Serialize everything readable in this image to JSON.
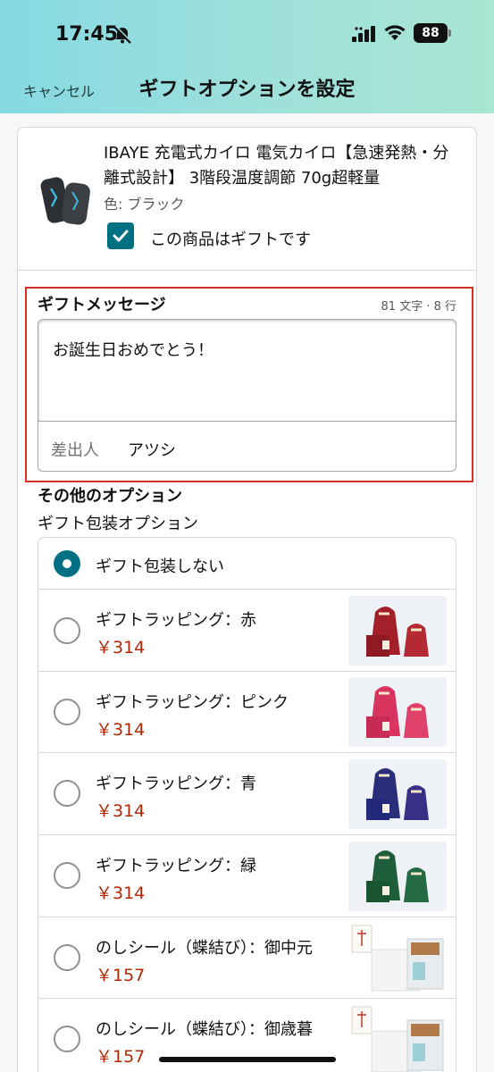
{
  "status_bar": {
    "time": "17:45",
    "battery": "88"
  },
  "nav": {
    "cancel": "キャンセル",
    "title": "ギフトオプションを設定"
  },
  "product": {
    "title": "IBAYE 充電式カイロ 電気カイロ【急速発熱・分離式設計】 3階段温度調節 70g超軽量",
    "color": "色: ブラック",
    "gift_checkbox_label": "この商品はギフトです",
    "gift_checked": true
  },
  "gift_message": {
    "heading": "ギフトメッセージ",
    "counter": "81 文字 · 8 行",
    "text": "お誕生日おめでとう！",
    "sender_label": "差出人",
    "sender_value": "アツシ"
  },
  "options": {
    "heading": "その他のオプション",
    "subheading": "ギフト包装オプション",
    "items": [
      {
        "label": "ギフト包装しない",
        "selected": true
      },
      {
        "label": "ギフトラッピング：赤",
        "price": "￥314",
        "color": "#a3202a"
      },
      {
        "label": "ギフトラッピング：ピンク",
        "price": "￥314",
        "color": "#d8345f"
      },
      {
        "label": "ギフトラッピング：青",
        "price": "￥314",
        "color": "#2a2d7a"
      },
      {
        "label": "ギフトラッピング：緑",
        "price": "￥314",
        "color": "#1f5e3a"
      },
      {
        "label": "のしシール（蝶結び）：御中元",
        "price": "￥157"
      },
      {
        "label": "のしシール（蝶結び）：御歳暮",
        "price": "￥157"
      }
    ]
  }
}
